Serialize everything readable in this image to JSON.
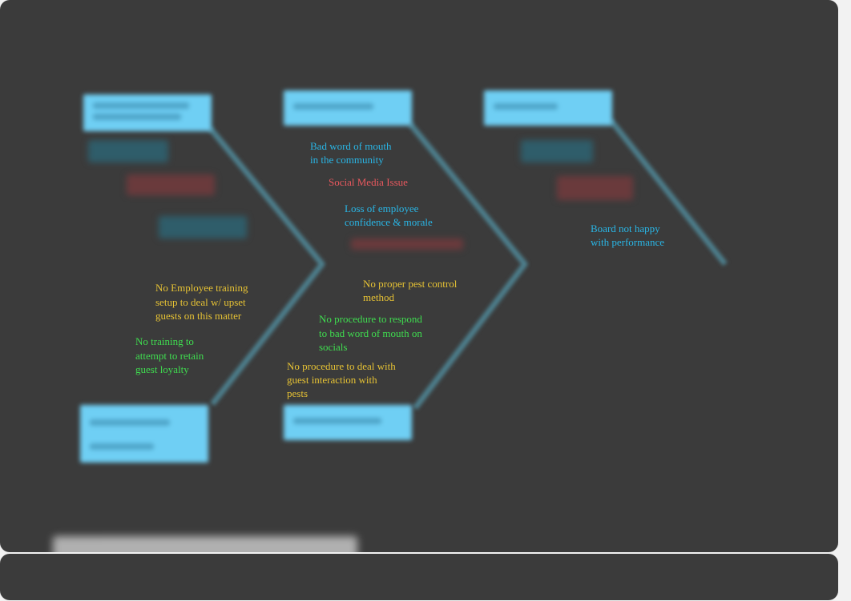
{
  "colors": {
    "background": "#3b3b3b",
    "bone": "#4d7f8d",
    "box": "#6fcff4",
    "blue": "#29b6e6",
    "red": "#e8585e",
    "yellow": "#e6c234",
    "green": "#3fdc4f"
  },
  "notes": [
    {
      "text": "Bad word of mouth\nin the community",
      "color": "blue"
    },
    {
      "text": "Social Media Issue",
      "color": "red"
    },
    {
      "text": "Loss of employee\nconfidence & morale",
      "color": "blue"
    },
    {
      "text": "Board not happy\nwith performance",
      "color": "blue"
    },
    {
      "text": "No Employee training\nsetup to deal w/ upset\nguests on this matter",
      "color": "yellow"
    },
    {
      "text": "No training to\nattempt to retain\nguest loyalty",
      "color": "green"
    },
    {
      "text": "No proper pest control\nmethod",
      "color": "yellow"
    },
    {
      "text": "No procedure to respond\nto bad word of mouth on\nsocials",
      "color": "green"
    },
    {
      "text": "No procedure to deal with\nguest interaction with\npests",
      "color": "yellow"
    }
  ]
}
